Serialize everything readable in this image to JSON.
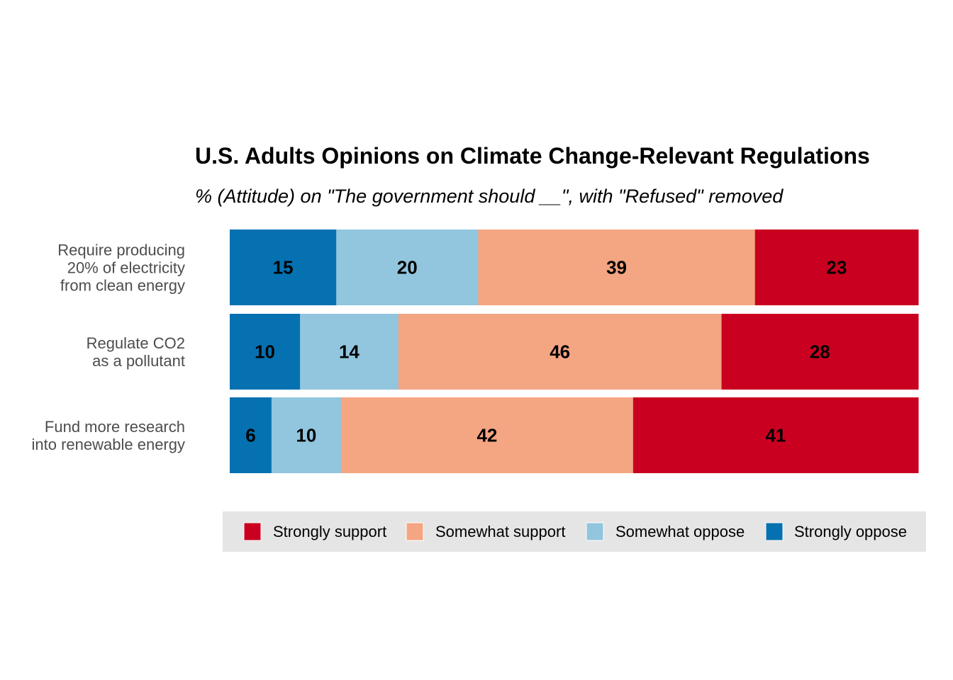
{
  "chart_data": {
    "type": "bar",
    "orientation": "horizontal",
    "stacked": true,
    "normalized": true,
    "title": "U.S. Adults Opinions on Climate Change-Relevant Regulations",
    "subtitle": "% (Attitude) on \"The government should __\", with \"Refused\" removed",
    "xlabel": "",
    "ylabel": "",
    "grid": false,
    "legend_position": "bottom",
    "categories": [
      [
        "Require producing",
        "20% of electricity",
        "from clean energy"
      ],
      [
        "Regulate CO2",
        "as a pollutant"
      ],
      [
        "Fund more research",
        "into renewable energy"
      ]
    ],
    "series": [
      {
        "name": "Strongly oppose",
        "color": "#0571B0",
        "values": [
          15,
          10,
          6
        ]
      },
      {
        "name": "Somewhat oppose",
        "color": "#92C5DE",
        "values": [
          20,
          14,
          10
        ]
      },
      {
        "name": "Somewhat support",
        "color": "#F4A582",
        "values": [
          39,
          46,
          42
        ]
      },
      {
        "name": "Strongly support",
        "color": "#CA0020",
        "values": [
          23,
          28,
          41
        ]
      }
    ],
    "legend_order": [
      "Strongly support",
      "Somewhat support",
      "Somewhat oppose",
      "Strongly oppose"
    ],
    "legend_background": "#E5E5E5"
  }
}
